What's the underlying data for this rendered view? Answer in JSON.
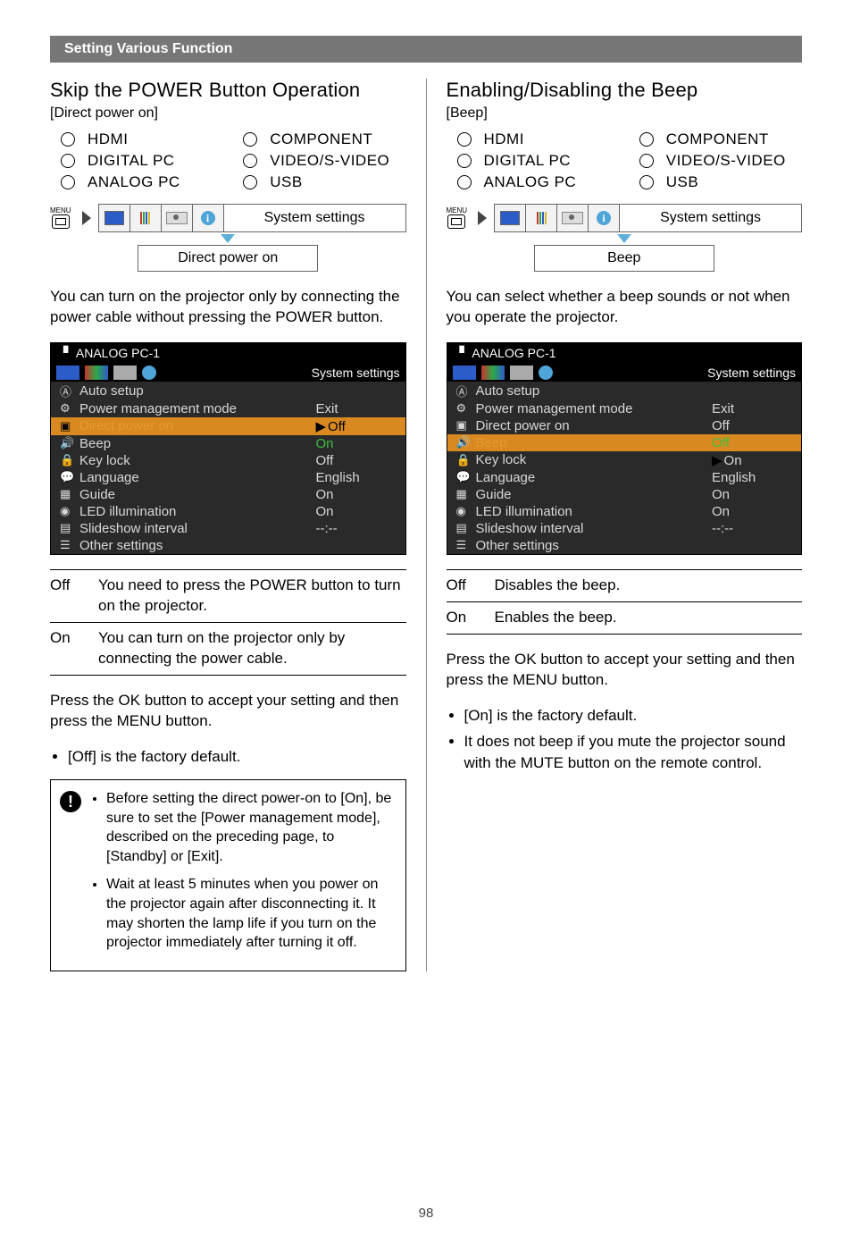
{
  "header": "Setting Various Function",
  "page_number": "98",
  "inputs": [
    "HDMI",
    "COMPONENT",
    "DIGITAL PC",
    "VIDEO/S-VIDEO",
    "ANALOG PC",
    "USB"
  ],
  "nav": {
    "menu_label": "MENU",
    "top_label": "System settings"
  },
  "left": {
    "title": "Skip the POWER Button Operation",
    "bracket": "[Direct power on]",
    "sub_label": "Direct power on",
    "intro": "You can turn on the projector only by connecting the power cable without pressing the POWER button.",
    "osd": {
      "title": "ANALOG PC-1",
      "right": "System settings",
      "rows": [
        {
          "icon": "Ⓐ",
          "lbl": "Auto setup",
          "val": ""
        },
        {
          "icon": "⚙",
          "lbl": "Power management mode",
          "val": "Exit"
        },
        {
          "icon": "▣",
          "lbl": "Direct power on",
          "val": "Off",
          "selected": true,
          "caret": true
        },
        {
          "icon": "🔊",
          "lbl": "Beep",
          "val": "On",
          "green": true
        },
        {
          "icon": "🔒",
          "lbl": "Key lock",
          "val": "Off"
        },
        {
          "icon": "💬",
          "lbl": "Language",
          "val": "English"
        },
        {
          "icon": "▦",
          "lbl": "Guide",
          "val": "On"
        },
        {
          "icon": "◉",
          "lbl": "LED illumination",
          "val": "On"
        },
        {
          "icon": "▤",
          "lbl": "Slideshow interval",
          "val": "--:--"
        },
        {
          "icon": "☰",
          "lbl": "Other settings",
          "val": ""
        }
      ]
    },
    "options": [
      {
        "k": "Off",
        "v": "You need to press the POWER button to turn on the projector."
      },
      {
        "k": "On",
        "v": "You can turn on the projector only by connecting the power cable."
      }
    ],
    "press": "Press the OK button to accept your setting and then press the MENU button.",
    "bullets": [
      "[Off] is the factory default."
    ],
    "notes": [
      "Before setting the direct power-on to [On], be sure to set the [Power management mode], described on the preceding page, to [Standby] or [Exit].",
      "Wait at least 5 minutes when you power on the projector again after disconnecting it. It may shorten the lamp life if you turn on the projector immediately after turning it off."
    ]
  },
  "right": {
    "title": "Enabling/Disabling the Beep",
    "bracket": "[Beep]",
    "sub_label": "Beep",
    "intro": "You can select whether a beep sounds or not when you operate the projector.",
    "osd": {
      "title": "ANALOG PC-1",
      "right": "System settings",
      "rows": [
        {
          "icon": "Ⓐ",
          "lbl": "Auto setup",
          "val": ""
        },
        {
          "icon": "⚙",
          "lbl": "Power management mode",
          "val": "Exit"
        },
        {
          "icon": "▣",
          "lbl": "Direct power on",
          "val": "Off"
        },
        {
          "icon": "🔊",
          "lbl": "Beep",
          "val": "Off",
          "selected": true,
          "green": true
        },
        {
          "icon": "🔒",
          "lbl": "Key lock",
          "val": "On",
          "caret": true
        },
        {
          "icon": "💬",
          "lbl": "Language",
          "val": "English"
        },
        {
          "icon": "▦",
          "lbl": "Guide",
          "val": "On"
        },
        {
          "icon": "◉",
          "lbl": "LED illumination",
          "val": "On"
        },
        {
          "icon": "▤",
          "lbl": "Slideshow interval",
          "val": "--:--"
        },
        {
          "icon": "☰",
          "lbl": "Other settings",
          "val": ""
        }
      ]
    },
    "options": [
      {
        "k": "Off",
        "v": "Disables the beep."
      },
      {
        "k": "On",
        "v": "Enables the beep."
      }
    ],
    "press": "Press the OK button to accept your setting and then press the MENU button.",
    "bullets": [
      "[On] is the factory default.",
      "It does not beep if you mute the projector sound with the MUTE button on the remote control."
    ]
  }
}
